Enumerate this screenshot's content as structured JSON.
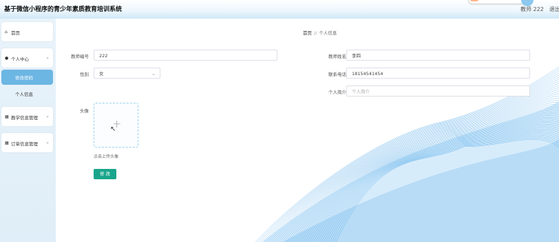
{
  "app": {
    "title": "基于微信小程序的青少年素质教育培训系统"
  },
  "header": {
    "user": "教师 222",
    "logout": "退出"
  },
  "sidebar": {
    "items": [
      {
        "label": "首页",
        "icon": "home-icon"
      },
      {
        "label": "个人中心",
        "icon": "user-icon",
        "children": [
          {
            "label": "修改密码",
            "active": true
          },
          {
            "label": "个人信息",
            "active": false
          }
        ]
      },
      {
        "label": "教学信息管理",
        "icon": "grid-icon"
      },
      {
        "label": "订单信息管理",
        "icon": "grid-icon"
      }
    ]
  },
  "breadcrumb": {
    "home": "首页",
    "sep": "//",
    "current": "个人信息"
  },
  "form": {
    "teacher_no": {
      "label": "教师编号",
      "value": "222"
    },
    "teacher_name": {
      "label": "教师姓名",
      "value": "李四"
    },
    "gender": {
      "label": "性别",
      "value": "女"
    },
    "phone": {
      "label": "联系电话",
      "value": "18154541454"
    },
    "intro": {
      "label": "个人简介",
      "placeholder": "个人简介"
    },
    "avatar": {
      "label": "头像",
      "hint": "点击上传头像"
    },
    "submit": "修 改"
  },
  "colors": {
    "accent": "#6cb6e3",
    "button": "#19a58b",
    "wave": "#1f8fe0"
  }
}
